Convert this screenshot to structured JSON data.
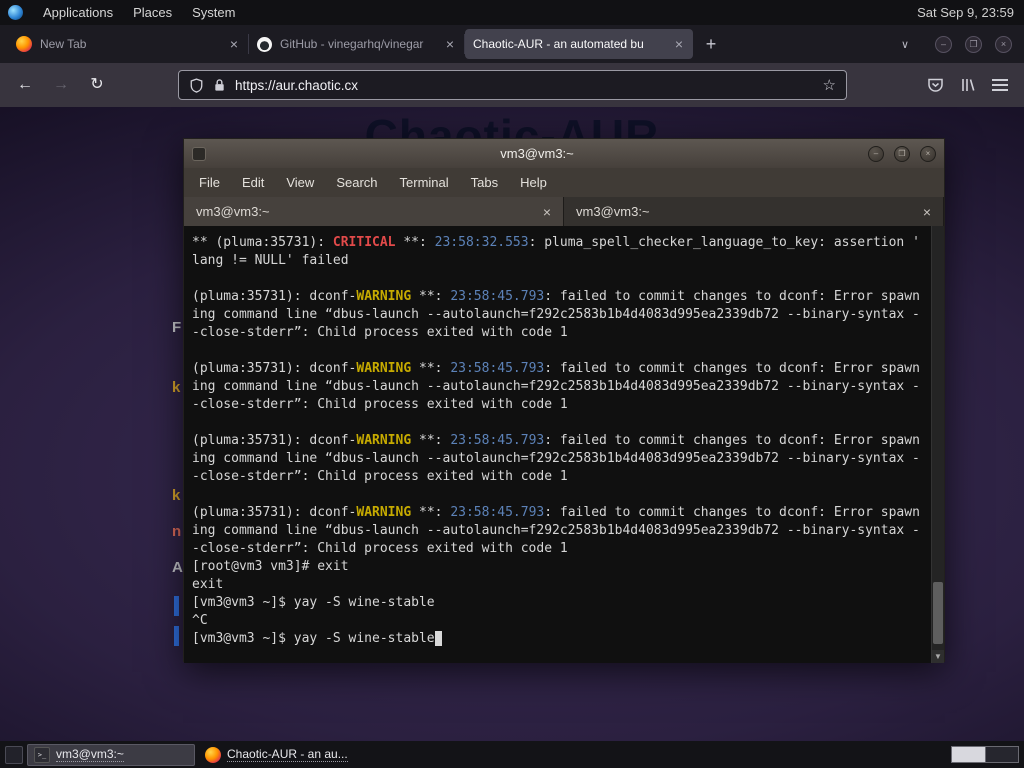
{
  "panel": {
    "menus": [
      "Applications",
      "Places",
      "System"
    ],
    "clock": "Sat Sep 9, 23:59"
  },
  "icons": {
    "close": "×",
    "new_tab": "+",
    "chevron_down": "∨",
    "back": "←",
    "forward": "→",
    "reload": "↻",
    "star": "☆",
    "minimize": "–",
    "maximize": "❒",
    "scroll_down": "▼",
    "terminal_glyph": ">_"
  },
  "browser": {
    "tabs": [
      {
        "label": "New Tab"
      },
      {
        "label": "GitHub - vinegarhq/vinegar"
      },
      {
        "label": "Chaotic-AUR - an automated bu"
      }
    ],
    "url": "https://aur.chaotic.cx"
  },
  "page": {
    "heading": "Chaotic-AUR",
    "fragments": [
      {
        "t": "F",
        "c": "#c9cacf"
      },
      {
        "t": "k",
        "c": "#d9a62a"
      },
      {
        "t": "k",
        "c": "#d9a62a"
      },
      {
        "t": "n",
        "c": "#e06c5a"
      },
      {
        "t": "A",
        "c": "#c9cacf"
      }
    ]
  },
  "terminal": {
    "title": "vm3@vm3:~",
    "menu": [
      "File",
      "Edit",
      "View",
      "Search",
      "Terminal",
      "Tabs",
      "Help"
    ],
    "tabs": [
      "vm3@vm3:~",
      "vm3@vm3:~"
    ],
    "lines": [
      [
        {
          "t": "** (pluma:35731): "
        },
        {
          "t": "CRITICAL",
          "c": "r"
        },
        {
          "t": " **: "
        },
        {
          "t": "23:58:32.553",
          "c": "b"
        },
        {
          "t": ": pluma_spell_checker_language_to_key: assertion '"
        }
      ],
      [
        {
          "t": "lang != NULL' failed"
        }
      ],
      [],
      [
        {
          "t": "(pluma:35731): dconf-"
        },
        {
          "t": "WARNING",
          "c": "y"
        },
        {
          "t": " **: "
        },
        {
          "t": "23:58:45.793",
          "c": "b"
        },
        {
          "t": ": failed to commit changes to dconf: Error spawn"
        }
      ],
      [
        {
          "t": "ing command line “dbus-launch --autolaunch=f292c2583b1b4d4083d995ea2339db72 --binary-syntax -"
        }
      ],
      [
        {
          "t": "-close-stderr”: Child process exited with code 1"
        }
      ],
      [],
      [
        {
          "t": "(pluma:35731): dconf-"
        },
        {
          "t": "WARNING",
          "c": "y"
        },
        {
          "t": " **: "
        },
        {
          "t": "23:58:45.793",
          "c": "b"
        },
        {
          "t": ": failed to commit changes to dconf: Error spawn"
        }
      ],
      [
        {
          "t": "ing command line “dbus-launch --autolaunch=f292c2583b1b4d4083d995ea2339db72 --binary-syntax -"
        }
      ],
      [
        {
          "t": "-close-stderr”: Child process exited with code 1"
        }
      ],
      [],
      [
        {
          "t": "(pluma:35731): dconf-"
        },
        {
          "t": "WARNING",
          "c": "y"
        },
        {
          "t": " **: "
        },
        {
          "t": "23:58:45.793",
          "c": "b"
        },
        {
          "t": ": failed to commit changes to dconf: Error spawn"
        }
      ],
      [
        {
          "t": "ing command line “dbus-launch --autolaunch=f292c2583b1b4d4083d995ea2339db72 --binary-syntax -"
        }
      ],
      [
        {
          "t": "-close-stderr”: Child process exited with code 1"
        }
      ],
      [],
      [
        {
          "t": "(pluma:35731): dconf-"
        },
        {
          "t": "WARNING",
          "c": "y"
        },
        {
          "t": " **: "
        },
        {
          "t": "23:58:45.793",
          "c": "b"
        },
        {
          "t": ": failed to commit changes to dconf: Error spawn"
        }
      ],
      [
        {
          "t": "ing command line “dbus-launch --autolaunch=f292c2583b1b4d4083d995ea2339db72 --binary-syntax -"
        }
      ],
      [
        {
          "t": "-close-stderr”: Child process exited with code 1"
        }
      ],
      [
        {
          "t": "[root@vm3 vm3]# exit"
        }
      ],
      [
        {
          "t": "exit"
        }
      ],
      [
        {
          "t": "[vm3@vm3 ~]$ yay -S wine-stable"
        }
      ],
      [
        {
          "t": "^C"
        }
      ],
      [
        {
          "t": "[vm3@vm3 ~]$ yay -S wine-stable"
        },
        {
          "t": " ",
          "c": "cur"
        }
      ]
    ]
  },
  "taskbar": {
    "items": [
      {
        "label": "vm3@vm3:~"
      },
      {
        "label": "Chaotic-AUR - an au..."
      }
    ]
  }
}
